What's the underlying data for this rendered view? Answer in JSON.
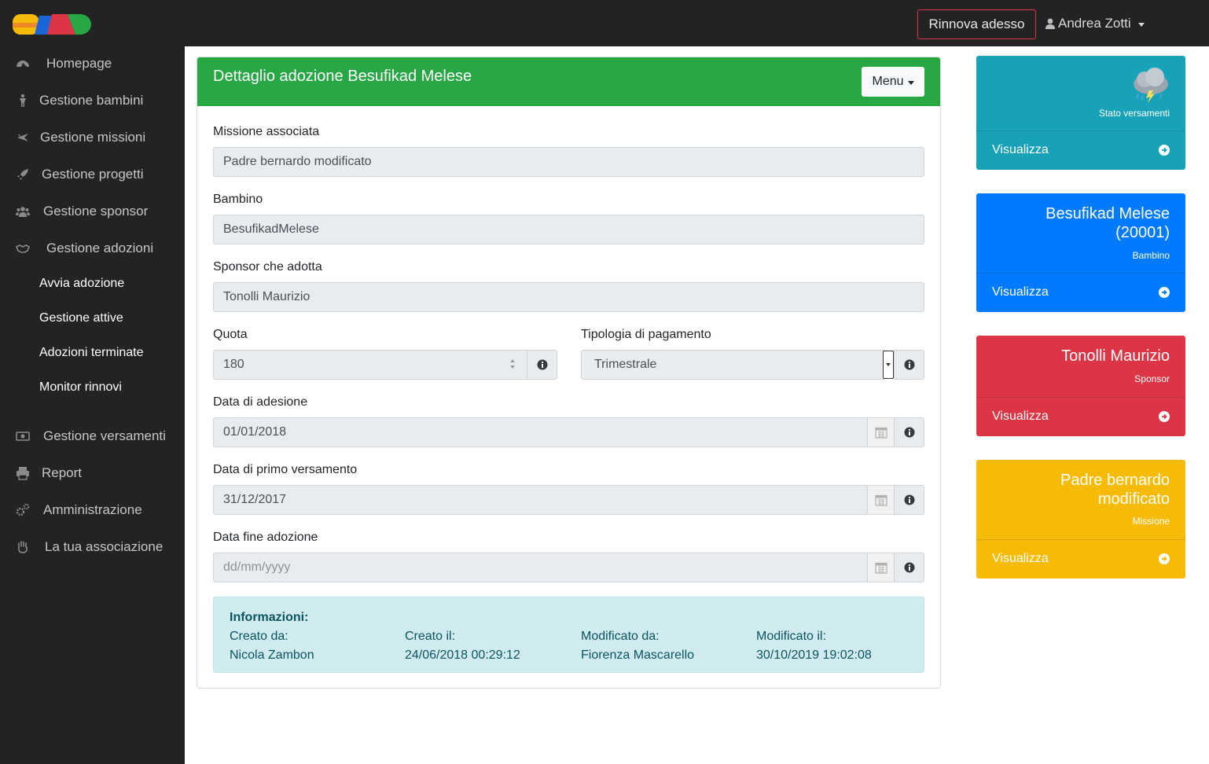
{
  "colors": {
    "topbar": "#232323",
    "header_green": "#28a745",
    "info": "#d1ecf1",
    "widget_teal": "#17a2b8",
    "widget_blue": "#007bff",
    "widget_red": "#dc3545",
    "widget_yellow": "#f6bb06"
  },
  "topbar": {
    "renew_label": "Rinnova adesso",
    "user_name": "Andrea Zotti"
  },
  "sidebar": {
    "items": [
      {
        "label": "Homepage",
        "icon": "dashboard-icon"
      },
      {
        "label": "Gestione bambini",
        "icon": "child-icon"
      },
      {
        "label": "Gestione missioni",
        "icon": "plane-icon"
      },
      {
        "label": "Gestione progetti",
        "icon": "rocket-icon"
      },
      {
        "label": "Gestione sponsor",
        "icon": "users-icon"
      },
      {
        "label": "Gestione adozioni",
        "icon": "handshake-icon"
      },
      {
        "label": "Gestione versamenti",
        "icon": "money-icon"
      },
      {
        "label": "Report",
        "icon": "print-icon"
      },
      {
        "label": "Amministrazione",
        "icon": "cogs-icon"
      },
      {
        "label": "La tua associazione",
        "icon": "hand-icon"
      }
    ],
    "subitems": [
      {
        "label": "Avvia adozione"
      },
      {
        "label": "Gestione attive"
      },
      {
        "label": "Adozioni terminate"
      },
      {
        "label": "Monitor rinnovi"
      }
    ]
  },
  "card": {
    "title": "Dettaglio adozione Besufikad Melese",
    "menu_label": "Menu",
    "fields": {
      "missione": {
        "label": "Missione associata",
        "value": "Padre bernardo modificato"
      },
      "bambino": {
        "label": "Bambino",
        "value": "BesufikadMelese"
      },
      "sponsor": {
        "label": "Sponsor che adotta",
        "value": "Tonolli Maurizio"
      },
      "quota": {
        "label": "Quota",
        "value": "180"
      },
      "tipologia": {
        "label": "Tipologia di pagamento",
        "value": "Trimestrale"
      },
      "adesione": {
        "label": "Data di adesione",
        "value": "01/01/2018"
      },
      "primo": {
        "label": "Data di primo versamento",
        "value": "31/12/2017"
      },
      "fine": {
        "label": "Data fine adozione",
        "placeholder": "dd/mm/yyyy"
      }
    },
    "info": {
      "title": "Informazioni:",
      "creato_da_label": "Creato da:",
      "creato_da": "Nicola Zambon",
      "creato_il_label": "Creato il:",
      "creato_il": "24/06/2018 00:29:12",
      "modificato_da_label": "Modificato da:",
      "modificato_da": "Fiorenza Mascarello",
      "modificato_il_label": "Modificato il:",
      "modificato_il": "30/10/2019 19:02:08"
    }
  },
  "widgets": {
    "stato": {
      "subtitle": "Stato versamenti",
      "link": "Visualizza",
      "icon": "storm-cloud-icon"
    },
    "bambino": {
      "title_line1": "Besufikad Melese",
      "title_line2": "(20001)",
      "subtitle": "Bambino",
      "link": "Visualizza"
    },
    "sponsor": {
      "title": "Tonolli Maurizio",
      "subtitle": "Sponsor",
      "link": "Visualizza"
    },
    "missione": {
      "title_line1": "Padre bernardo",
      "title_line2": "modificato",
      "subtitle": "Missione",
      "link": "Visualizza"
    }
  }
}
